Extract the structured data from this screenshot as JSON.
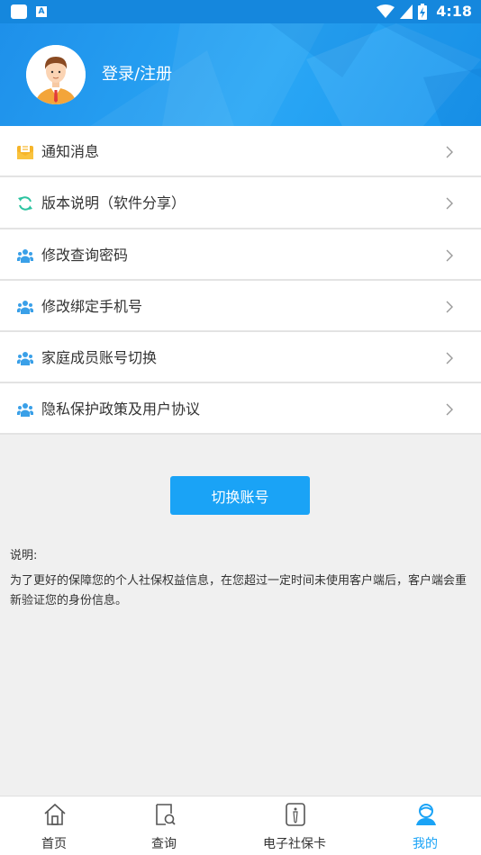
{
  "status_bar": {
    "time": "4:18"
  },
  "header": {
    "login_label": "登录/注册"
  },
  "menu": [
    {
      "label": "通知消息",
      "icon": "mail-icon"
    },
    {
      "label": "版本说明（软件分享）",
      "icon": "refresh-icon"
    },
    {
      "label": "修改查询密码",
      "icon": "users-icon"
    },
    {
      "label": "修改绑定手机号",
      "icon": "users-icon"
    },
    {
      "label": "家庭成员账号切换",
      "icon": "users-icon"
    },
    {
      "label": "隐私保护政策及用户协议",
      "icon": "users-icon"
    }
  ],
  "switch_button": "切换账号",
  "note": {
    "title": "说明:",
    "text": "为了更好的保障您的个人社保权益信息，在您超过一定时间未使用客户端后，客户端会重新验证您的身份信息。"
  },
  "bottom_nav": [
    {
      "label": "首页",
      "icon": "home-icon",
      "active": false
    },
    {
      "label": "查询",
      "icon": "search-doc-icon",
      "active": false
    },
    {
      "label": "电子社保卡",
      "icon": "card-icon",
      "active": false
    },
    {
      "label": "我的",
      "icon": "user-icon",
      "active": true
    }
  ],
  "colors": {
    "primary": "#1aa3f6",
    "header": "#1e90ea"
  }
}
